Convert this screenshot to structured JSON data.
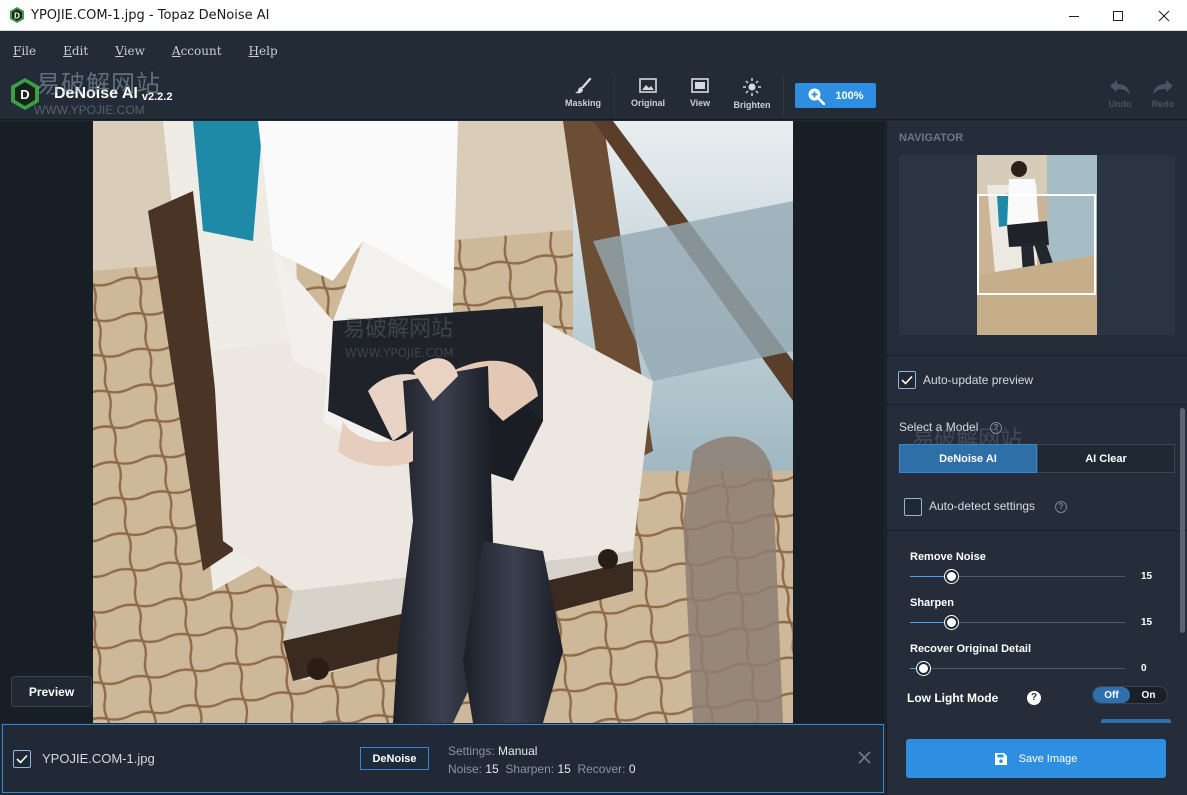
{
  "window": {
    "title": "YPOJIE.COM-1.jpg - Topaz DeNoise AI",
    "minimize_label": "—",
    "maximize_label": "☐",
    "close_label": "✕"
  },
  "menu": {
    "items": [
      {
        "label": "File",
        "accel": "F",
        "rest": "ile"
      },
      {
        "label": "Edit",
        "accel": "E",
        "rest": "dit"
      },
      {
        "label": "View",
        "accel": "V",
        "rest": "iew"
      },
      {
        "label": "Account",
        "accel": "A",
        "rest": "ccount"
      },
      {
        "label": "Help",
        "accel": "H",
        "rest": "elp"
      }
    ]
  },
  "brand": {
    "name": "DeNoise AI",
    "version": "v2.2.2",
    "logo_letter": "D",
    "accent": "#3aa043"
  },
  "watermark": {
    "text": "易破解网站",
    "sub": "WWW.YPOJIE.COM"
  },
  "toolbar": {
    "masking": "Masking",
    "original": "Original",
    "view": "View",
    "brighten": "Brighten",
    "zoom": "100%",
    "undo": "Undo",
    "redo": "Redo"
  },
  "canvas": {
    "preview_button": "Preview"
  },
  "panel": {
    "navigator_label": "NAVIGATOR",
    "auto_update_label": "Auto-update preview",
    "auto_update_checked": true,
    "select_model_label": "Select a Model",
    "models": [
      "DeNoise AI",
      "AI Clear"
    ],
    "active_model": "DeNoise AI",
    "auto_detect_label": "Auto-detect settings",
    "auto_detect_checked": false,
    "sliders": [
      {
        "label": "Remove Noise",
        "value": "15",
        "fraction": 0.19
      },
      {
        "label": "Sharpen",
        "value": "15",
        "fraction": 0.19
      },
      {
        "label": "Recover Original Detail",
        "value": "0",
        "fraction": 0.06
      }
    ],
    "low_light_label": "Low Light Mode",
    "low_light_off": "Off",
    "low_light_on": "On",
    "help_glyph": "?",
    "save_button": "Save Image"
  },
  "filebar": {
    "checked": true,
    "filename": "YPOJIE.COM-1.jpg",
    "denoise_button": "DeNoise",
    "settings_label": "Settings:",
    "settings_value": "Manual",
    "noise_label": "Noise:",
    "noise_value": "15",
    "sharpen_label": "Sharpen:",
    "sharpen_value": "15",
    "recover_label": "Recover:",
    "recover_value": "0",
    "close_glyph": "✕"
  },
  "colors": {
    "accent_blue": "#2e8fe2",
    "panel_bg": "#242d39",
    "canvas_bg": "#171e26"
  }
}
